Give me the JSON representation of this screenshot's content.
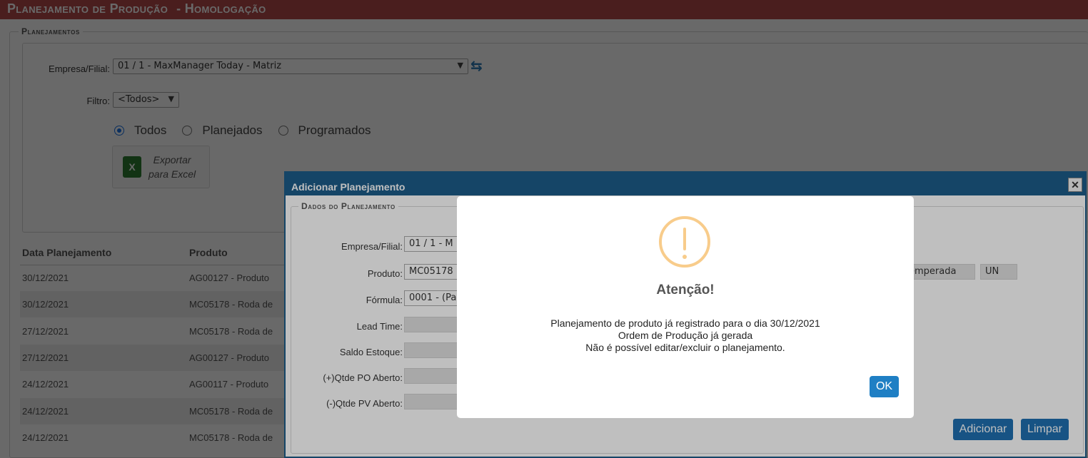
{
  "header": {
    "title": "Planejamento de Produção",
    "env": "- Homologação"
  },
  "planejamentos": {
    "legend": "Planejamentos",
    "empresa_label": "Empresa/Filial:",
    "empresa_value": "01 / 1 - MaxManager Today - Matriz",
    "filtro_label": "Filtro:",
    "filtro_value": "<Todos>",
    "radios": [
      "Todos",
      "Planejados",
      "Programados"
    ],
    "export_label_1": "Exportar",
    "export_label_2": "para Excel"
  },
  "grid": {
    "columns": [
      "Data Planejamento",
      "Produto"
    ],
    "rows": [
      [
        "30/12/2021",
        "AG00127 - Produto"
      ],
      [
        "30/12/2021",
        "MC05178 - Roda de"
      ],
      [
        "27/12/2021",
        "MC05178 - Roda de"
      ],
      [
        "27/12/2021",
        "AG00127 - Produto"
      ],
      [
        "24/12/2021",
        "AG00117 - Produto"
      ],
      [
        "24/12/2021",
        "MC05178 - Roda de"
      ],
      [
        "24/12/2021",
        "MC05178 - Roda de"
      ]
    ]
  },
  "dialog": {
    "title": "Adicionar Planejamento",
    "close": "✕",
    "legend": "Dados do Planejamento",
    "empresa_label": "Empresa/Filial:",
    "empresa_value": "01 / 1 - M",
    "produto_label": "Produto:",
    "produto_value": "MC05178",
    "produto_desc_tail": "emperada",
    "produto_unit": "UN",
    "formula_label": "Fórmula:",
    "formula_value": "0001 - (Pa",
    "lead_label": "Lead Time:",
    "saldo_label": "Saldo Estoque:",
    "po_label": "(+)Qtde PO Aberto:",
    "pv_label": "(-)Qtde PV Aberto:",
    "add_button": "Adicionar",
    "clear_button": "Limpar"
  },
  "alert": {
    "title": "Atenção!",
    "line1": "Planejamento de produto já registrado para o dia 30/12/2021",
    "line2": "Ordem de Produção já gerada",
    "line3": "Não é possível editar/excluir o planejamento.",
    "ok": "OK"
  },
  "colors": {
    "header": "#b54a4a",
    "dialog_header": "#1d5c8a",
    "button": "#1f6fb0",
    "warning": "#f8cc8b"
  }
}
